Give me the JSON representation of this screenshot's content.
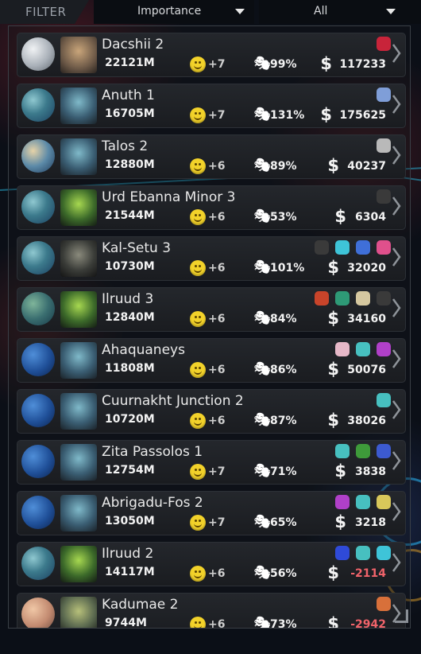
{
  "header": {
    "filter_label": "FILTER",
    "sort_label": "Importance",
    "scope_label": "All"
  },
  "colors": {
    "negative_credits": "#f0636a",
    "happiness_face": "#f2d22a"
  },
  "planets": [
    {
      "name": "Dacshii 2",
      "population": "22121M",
      "happiness": "+7",
      "approval": "99%",
      "credits": "117233",
      "planet_type": "ice",
      "species_icon": "horned-alien-portrait",
      "resources": [
        "red-drink-icon"
      ]
    },
    {
      "name": "Anuth 1",
      "population": "16705M",
      "happiness": "+7",
      "approval": "131%",
      "credits": "175625",
      "planet_type": "ocean-continent",
      "species_icon": "blue-alien-portrait",
      "resources": [
        "blue-crystal-icon"
      ]
    },
    {
      "name": "Talos 2",
      "population": "12880M",
      "happiness": "+6",
      "approval": "89%",
      "credits": "40237",
      "planet_type": "desert-continent",
      "species_icon": "blue-alien-portrait",
      "resources": [
        "metal-bar-icon"
      ]
    },
    {
      "name": "Urd Ebanna Minor 3",
      "population": "21544M",
      "happiness": "+6",
      "approval": "53%",
      "credits": "6304",
      "planet_type": "ocean-continent",
      "species_icon": "green-insect-portrait",
      "resources": [
        "dark-ore-icon"
      ]
    },
    {
      "name": "Kal-Setu 3",
      "population": "10730M",
      "happiness": "+6",
      "approval": "101%",
      "credits": "32020",
      "planet_type": "ocean-continent",
      "species_icon": "armored-alien-portrait",
      "resources": [
        "dark-ore-icon",
        "cyan-spheres-icon",
        "blue-gems-icon",
        "pink-potion-icon"
      ]
    },
    {
      "name": "Ilruud 3",
      "population": "12840M",
      "happiness": "+6",
      "approval": "84%",
      "credits": "34160",
      "planet_type": "jungle",
      "species_icon": "green-insect-portrait",
      "resources": [
        "red-flower-icon",
        "green-crystal-icon",
        "beige-crate-icon",
        "dark-ore-icon"
      ]
    },
    {
      "name": "Ahaquaneys",
      "population": "11808M",
      "happiness": "+6",
      "approval": "86%",
      "credits": "50076",
      "planet_type": "ocean",
      "species_icon": "blue-alien-portrait",
      "resources": [
        "pink-spheres-icon",
        "teal-spores-icon",
        "magenta-cloth-icon"
      ]
    },
    {
      "name": "Cuurnakht Junction 2",
      "population": "10720M",
      "happiness": "+6",
      "approval": "87%",
      "credits": "38026",
      "planet_type": "ocean",
      "species_icon": "blue-alien-portrait",
      "resources": [
        "teal-spores-icon"
      ]
    },
    {
      "name": "Zita Passolos 1",
      "population": "12754M",
      "happiness": "+7",
      "approval": "71%",
      "credits": "3838",
      "planet_type": "ocean",
      "species_icon": "blue-alien-portrait",
      "resources": [
        "teal-spores-icon",
        "green-plant-icon",
        "blue-leaf-icon"
      ]
    },
    {
      "name": "Abrigadu-Fos 2",
      "population": "13050M",
      "happiness": "+7",
      "approval": "65%",
      "credits": "3218",
      "planet_type": "ocean",
      "species_icon": "blue-alien-portrait",
      "resources": [
        "magenta-cloth-icon",
        "teal-spores-icon",
        "gold-crate-icon"
      ]
    },
    {
      "name": "Ilruud 2",
      "population": "14117M",
      "happiness": "+6",
      "approval": "56%",
      "credits": "-2114",
      "negative": true,
      "planet_type": "ocean-continent",
      "species_icon": "green-insect-portrait",
      "resources": [
        "blue-orb-icon",
        "teal-spores-icon",
        "cyan-spheres-icon"
      ]
    },
    {
      "name": "Kadumae 2",
      "population": "9744M",
      "happiness": "+6",
      "approval": "73%",
      "credits": "-2942",
      "negative": true,
      "planet_type": "desert",
      "species_icon": "reptile-alien-portrait",
      "resources": [
        "orange-pipe-icon"
      ]
    }
  ]
}
